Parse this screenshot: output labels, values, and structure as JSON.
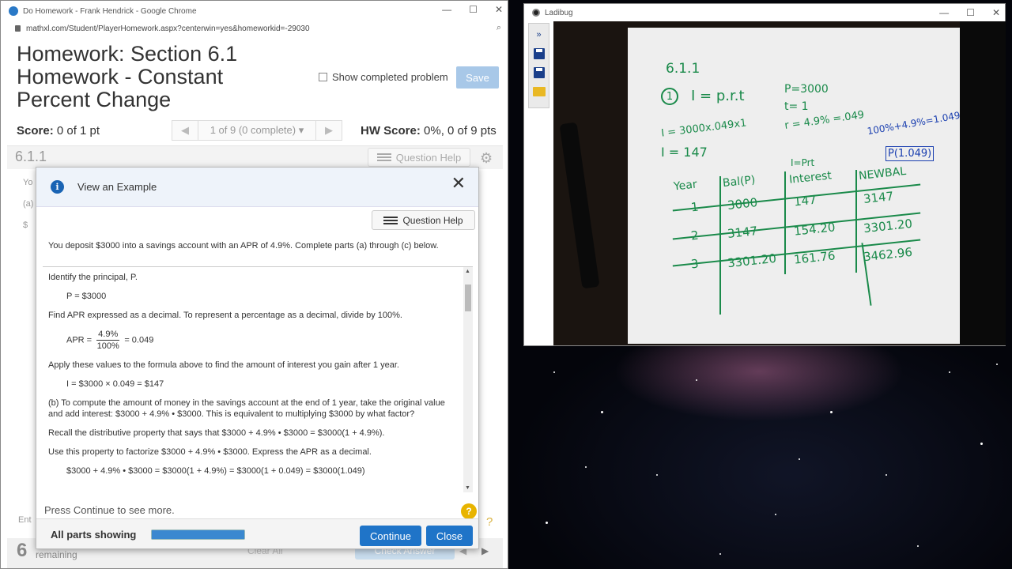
{
  "chrome": {
    "tab_title": "Do Homework - Frank Hendrick - Google Chrome",
    "url": "mathxl.com/Student/PlayerHomework.aspx?centerwin=yes&homeworkid=-29030"
  },
  "homework": {
    "title": "Homework: Section 6.1 Homework - Constant Percent Change",
    "show_completed": "Show completed problem",
    "save": "Save",
    "score_label": "Score:",
    "score_value": "0 of 1 pt",
    "nav_text": "1 of 9 (0 complete)",
    "hw_score_label": "HW Score:",
    "hw_score_value": "0%, 0 of 9 pts",
    "question_number": "6.1.1",
    "question_help": "Question Help",
    "bg_you": "Yo",
    "bg_a": "(a)",
    "bg_dollar": "$",
    "bg_ent": "Ent",
    "remaining_count": "6",
    "remaining": "remaining",
    "clear_all": "Clear All",
    "check_answer": "Check Answer"
  },
  "modal": {
    "title": "View an Example",
    "question_help": "Question Help",
    "problem": "You deposit $3000 into a savings account with an APR of 4.9%. Complete parts (a) through (c) below.",
    "lines": {
      "identify": "Identify the principal, P.",
      "p_eq": "P = $3000",
      "find_apr": "Find APR expressed as a decimal. To represent a percentage as a decimal, divide by 100%.",
      "apr_label": "APR =",
      "apr_num": "4.9%",
      "apr_den": "100%",
      "apr_result": "= 0.049",
      "apply": "Apply these values to the formula above to find the amount of interest you gain after 1 year.",
      "interest_eq": "I = $3000 × 0.049 = $147",
      "part_b": "(b) To compute the amount of money in the savings account at the end of 1 year, take the original value and add interest: $3000 + 4.9% • $3000. This is equivalent to multiplying $3000 by what factor?",
      "recall": "Recall the distributive property that says that $3000 + 4.9% • $3000 = $3000(1 + 4.9%).",
      "use_property": "Use this property to factorize $3000 + 4.9% • $3000. Express the APR as a decimal.",
      "factor_eq": "$3000 + 4.9% • $3000 = $3000(1 + 4.9%) = $3000(1 + 0.049)  = $3000(1.049)"
    },
    "press_continue": "Press Continue to see more.",
    "all_parts": "All parts showing",
    "progress": 1.0,
    "continue": "Continue",
    "close": "Close"
  },
  "ladibug": {
    "title": "Ladibug",
    "notes": {
      "section": "6.1.1",
      "circle_num": "1",
      "formula": "I = p.r.t",
      "p_val": "P=3000",
      "t_val": "t= 1",
      "r_val": "r = 4.9% =.049",
      "calc": "I = 3000x.049x1",
      "result": "I = 147",
      "factor": "100%+4.9%=1.049",
      "factor_box": "P(1.049)",
      "iprt": "I=Prt",
      "headers": [
        "Year",
        "Bal(P)",
        "Interest",
        "NEWBAL"
      ],
      "rows": [
        [
          "1",
          "3000",
          "147",
          "3147"
        ],
        [
          "2",
          "3147",
          "154.20",
          "3301.20"
        ],
        [
          "3",
          "3301.20",
          "161.76",
          "3462.96"
        ]
      ]
    }
  }
}
